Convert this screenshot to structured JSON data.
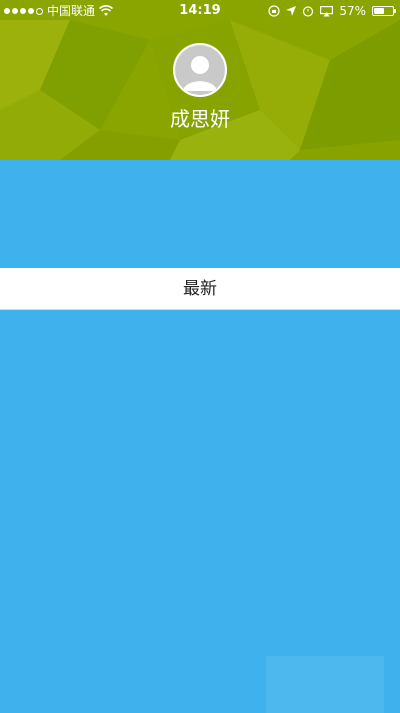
{
  "status_bar": {
    "carrier": "中国联通",
    "time": "14:19",
    "battery_percent": "57%",
    "battery_level": 0.57,
    "icons": [
      "signal-dots-icon",
      "wifi-icon",
      "rotation-lock-icon",
      "location-icon",
      "alarm-icon",
      "airplay-icon",
      "battery-icon"
    ]
  },
  "profile": {
    "name": "成思妍",
    "avatar_icon": "default-user-avatar-icon"
  },
  "section": {
    "title": "最新"
  },
  "colors": {
    "banner": "#8aa400",
    "content_background": "#3fb1ec",
    "section_bar": "#ffffff"
  }
}
